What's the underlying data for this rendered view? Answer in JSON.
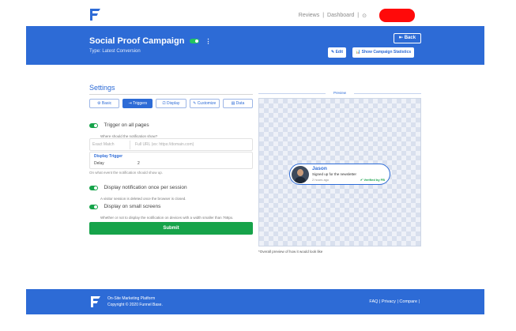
{
  "nav": {
    "links": [
      "Reviews",
      "|",
      "Dashboard",
      "|",
      "⊙"
    ]
  },
  "header": {
    "title": "Social Proof Campaign",
    "subtitle": "Type: Latest Conversion",
    "back_button": "⇤ Back",
    "edit_button": "✎ Edit",
    "stats_button": "📊 Show Campaign Statistics"
  },
  "settings": {
    "title": "Settings",
    "tabs": [
      "⚙ Basic",
      "⇥ Triggers",
      "⎚ Display",
      "✎ Customize",
      "▤ Data"
    ],
    "trigger_all_pages": {
      "label": "Trigger on all pages",
      "desc": "Where should the notification show?"
    },
    "url_match": {
      "select": "Exact Match",
      "placeholder": "Full URL (ex: https://domain.com)"
    },
    "display_trigger": {
      "heading": "Display Trigger",
      "value": "Delay",
      "number": "2"
    },
    "trigger_hint": "On what event the notification should show up.",
    "once_per_session": {
      "label": "Display notification once per session",
      "desc": "A visitor session is deleted once the browser is closed."
    },
    "small_screens": {
      "label": "Display on small screens",
      "desc": "Whether or not to display the notification on devices with a width smaller than 768px."
    },
    "submit": "Submit"
  },
  "preview": {
    "label": "Preview",
    "name": "Jason",
    "message": "Signed up for the newsletter",
    "time": "2 hours ago",
    "verified": "✔ Verified by FB",
    "note": "*Overall preview of how it would look like"
  },
  "footer": {
    "tagline": "On-Site Marketing Platform",
    "copyright": "Copyright © 2020 Funnel Base.",
    "links": "FAQ | Privacy | Compare |"
  },
  "colors": {
    "brand_blue": "#2d6bd6",
    "toggle_green": "#16a34a",
    "redaction": "#ff0a0a"
  }
}
